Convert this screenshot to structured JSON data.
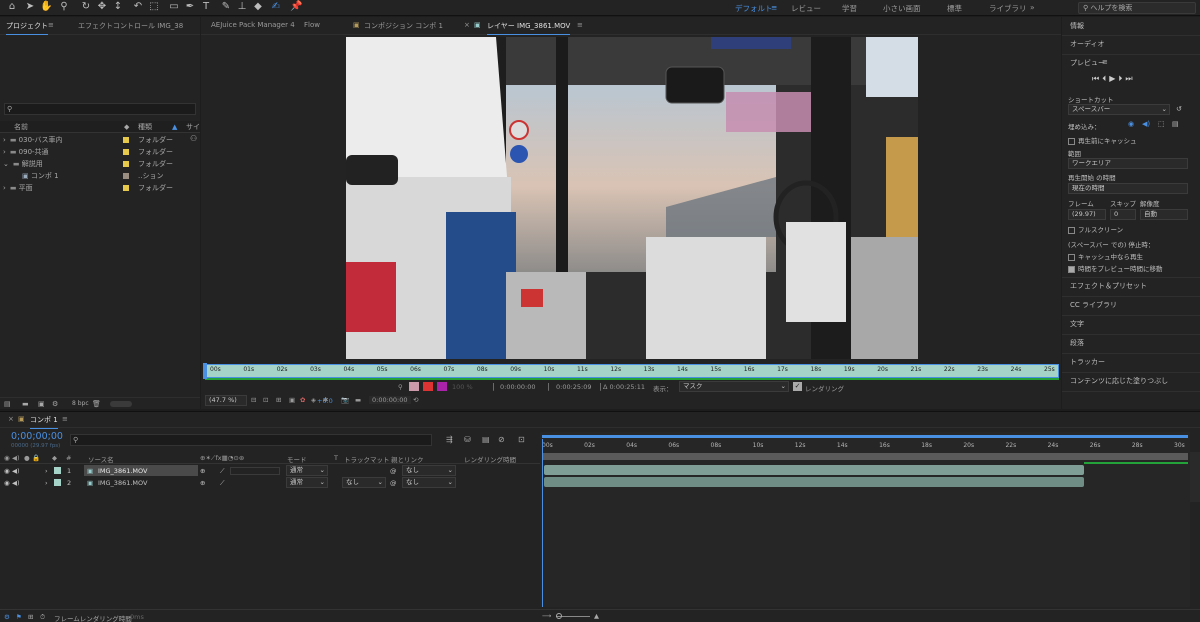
{
  "toolbar": {
    "workspaces": [
      "デフォルト",
      "レビュー",
      "学習",
      "小さい画面",
      "標準",
      "ライブラリ"
    ],
    "search_placeholder": "ヘルプを検索"
  },
  "project": {
    "tabs": [
      "プロジェクト",
      "エフェクトコントロール IMG_38"
    ],
    "columns": {
      "name": "名前",
      "type": "種類",
      "size": "サイ"
    },
    "items": [
      {
        "name": "030-バス車内",
        "type": "フォルダー",
        "color": "#e6c84a"
      },
      {
        "name": "090-共通",
        "type": "フォルダー",
        "color": "#e6c84a"
      },
      {
        "name": "解説用",
        "type": "フォルダー",
        "color": "#e6c84a"
      },
      {
        "name": "コンポ 1",
        "type": "..ション",
        "color": "#9a8e82"
      },
      {
        "name": "平面",
        "type": "フォルダー",
        "color": "#e6c84a"
      }
    ],
    "bpc": "8 bpc"
  },
  "viewer": {
    "tabs": [
      "AEJuice Pack Manager 4",
      "Flow",
      "コンポジション コンポ 1",
      "レイヤー IMG_3861.MOV"
    ],
    "ticks": [
      "00s",
      "01s",
      "02s",
      "03s",
      "04s",
      "05s",
      "06s",
      "07s",
      "08s",
      "09s",
      "10s",
      "11s",
      "12s",
      "13s",
      "14s",
      "15s",
      "16s",
      "17s",
      "18s",
      "19s",
      "20s",
      "21s",
      "22s",
      "23s",
      "24s",
      "25s"
    ],
    "time_in": "0:00:00:00",
    "time_out": "0:00:25:09",
    "duration": "Δ 0:00:25:11",
    "view_label": "表示：",
    "view_mode": "マスク",
    "render_label": "レンダリング",
    "zoom": "(47.7 %)",
    "current_time": "0:00:00:00",
    "exposure": "+0.0",
    "opacity": "100 %"
  },
  "right_panel": {
    "items_top": [
      "情報",
      "オーディオ",
      "プレビュー"
    ],
    "shortcut_label": "ショートカット",
    "shortcut_value": "スペースバー",
    "include_label": "埋め込み：",
    "cache_before": "再生前にキャッシュ",
    "range_label": "範囲",
    "range_value": "ワークエリア",
    "start_label": "再生開始 の時間",
    "start_value": "現在の時間",
    "frame_label": "フレーム",
    "skip_label": "スキップ",
    "res_label": "解像度",
    "frame_value": "(29.97)",
    "skip_value": "0",
    "res_value": "自動",
    "fullscreen": "フルスクリーン",
    "stop_label": "(スペースバー での) 停止時：",
    "stop_cache": "キャッシュ中なら再生",
    "stop_move": "時間をプレビュー時間に移動",
    "items_bottom": [
      "エフェクト＆プリセット",
      "CC ライブラリ",
      "文字",
      "段落",
      "トラッカー",
      "コンテンツに応じた塗りつぶし"
    ]
  },
  "timeline": {
    "tab": "コンポ 1",
    "timecode": "0;00;00;00",
    "fps": "00000 (29.97 fps)",
    "columns": {
      "num": "#",
      "source": "ソース名",
      "mode": "モード",
      "t": "T",
      "track": "トラックマット",
      "parent": "親とリンク",
      "render_time": "レンダリング時間"
    },
    "layers": [
      {
        "num": "1",
        "name": "IMG_3861.MOV",
        "mode": "通常",
        "track": "",
        "parent": "なし"
      },
      {
        "num": "2",
        "name": "IMG_3861.MOV",
        "mode": "通常",
        "track": "なし",
        "parent": "なし"
      }
    ],
    "ticks": [
      "00s",
      "02s",
      "04s",
      "06s",
      "08s",
      "10s",
      "12s",
      "14s",
      "16s",
      "18s",
      "20s",
      "22s",
      "24s",
      "26s",
      "28s",
      "30s"
    ],
    "footer": "フレームレンダリング時間",
    "footer_ms": "0ms"
  }
}
